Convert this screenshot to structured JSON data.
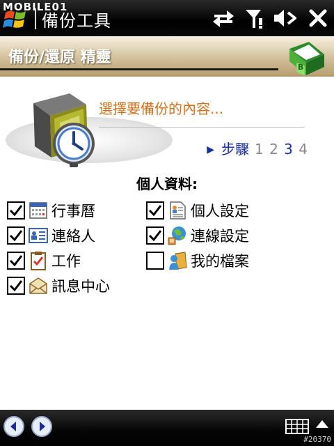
{
  "titlebar": {
    "watermark": "MOBILE01",
    "app_title": "備份工具",
    "icons": [
      "start-flag-icon",
      "connectivity-icon",
      "signal-icon",
      "speaker-muted-icon",
      "close-icon"
    ]
  },
  "header": {
    "title": "備份/還原 精靈",
    "icon": "backup-folder-icon"
  },
  "wizard": {
    "prompt": "選擇要備份的內容...",
    "steps_label": "步驟",
    "steps": [
      "1",
      "2",
      "3",
      "4"
    ],
    "current_step": "3"
  },
  "section_title": "個人資料:",
  "options": {
    "calendar": {
      "label": "行事曆",
      "checked": true,
      "icon": "calendar-icon"
    },
    "personal_settings": {
      "label": "個人設定",
      "checked": true,
      "icon": "personal-settings-icon"
    },
    "contacts": {
      "label": "連絡人",
      "checked": true,
      "icon": "contacts-card-icon"
    },
    "connection_settings": {
      "label": "連線設定",
      "checked": true,
      "icon": "globe-connection-icon"
    },
    "tasks": {
      "label": "工作",
      "checked": true,
      "icon": "tasks-clipboard-icon"
    },
    "my_documents": {
      "label": "我的檔案",
      "checked": false,
      "icon": "my-documents-icon"
    },
    "messaging": {
      "label": "訊息中心",
      "checked": true,
      "icon": "messaging-envelope-icon"
    }
  },
  "bottombar": {
    "back": "back-arrow-icon",
    "next": "next-arrow-icon",
    "keyboard": "keyboard-icon",
    "watermark": "#20370"
  },
  "colors": {
    "prompt": "#d4701c",
    "steps": "#1a2f9a"
  }
}
